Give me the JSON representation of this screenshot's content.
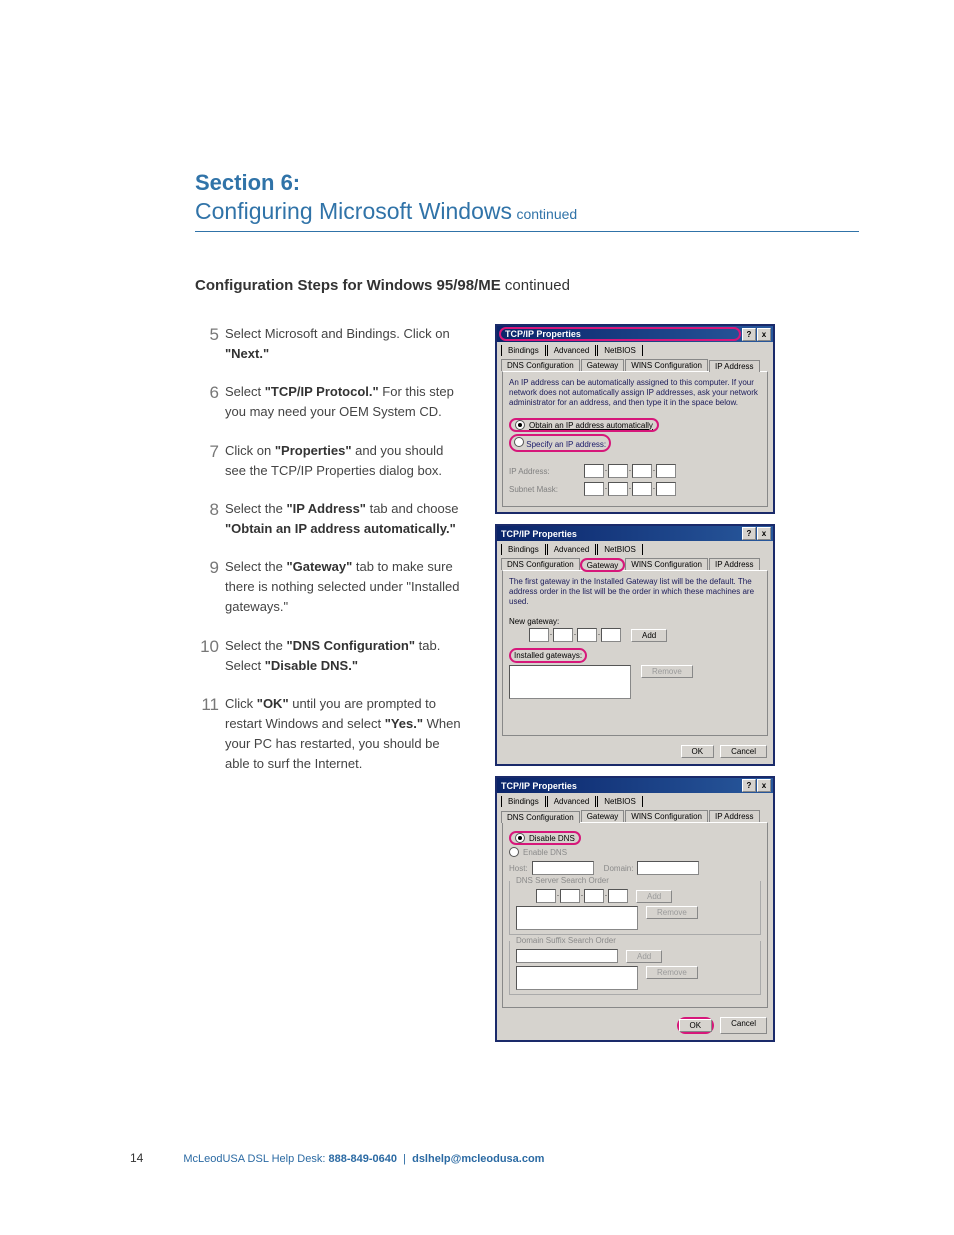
{
  "section": {
    "number": "Section 6:",
    "title": "Configuring Microsoft Windows",
    "cont": "continued"
  },
  "subhead": {
    "text": "Configuration Steps for Windows 95/98/ME",
    "cont": "continued"
  },
  "steps": [
    {
      "n": "5",
      "html": "Select Microsoft and Bindings. Click on <b>\"Next.\"</b>"
    },
    {
      "n": "6",
      "html": "Select <b>\"TCP/IP Protocol.\"</b> For this step you may need your OEM System CD."
    },
    {
      "n": "7",
      "html": "Click on <b>\"Properties\"</b> and you should see the TCP/IP Properties dialog box."
    },
    {
      "n": "8",
      "html": "Select the <b>\"IP Address\"</b> tab and choose <b>\"Obtain an IP address automatically.\"</b>"
    },
    {
      "n": "9",
      "html": "Select the <b>\"Gateway\"</b> tab to make sure there is nothing selected under \"Installed gateways.\""
    },
    {
      "n": "10",
      "html": "Select the <b>\"DNS Configuration\"</b> tab. Select <b>\"Disable DNS.\"</b>"
    },
    {
      "n": "11",
      "html": "Click <b>\"OK\"</b> until you are prompted to restart Windows and select <b>\"Yes.\"</b> When your PC has restarted, you should be able to surf the Internet."
    }
  ],
  "dialog": {
    "title": "TCP/IP Properties",
    "help": "?",
    "close": "x",
    "tabs_top": [
      "Bindings",
      "Advanced",
      "NetBIOS"
    ],
    "tabs_bot": [
      "DNS Configuration",
      "Gateway",
      "WINS Configuration",
      "IP Address"
    ],
    "ip": {
      "note": "An IP address can be automatically assigned to this computer. If your network does not automatically assign IP addresses, ask your network administrator for an address, and then type it in the space below.",
      "r1": "Obtain an IP address automatically",
      "r2": "Specify an IP address:",
      "f1": "IP Address:",
      "f2": "Subnet Mask:"
    },
    "gw": {
      "note": "The first gateway in the Installed Gateway list will be the default. The address order in the list will be the order in which these machines are used.",
      "new": "New gateway:",
      "add": "Add",
      "inst": "Installed gateways:",
      "remove": "Remove",
      "ok": "OK",
      "cancel": "Cancel"
    },
    "dns": {
      "r1": "Disable DNS",
      "r2": "Enable DNS",
      "host": "Host:",
      "domain": "Domain:",
      "order": "DNS Server Search Order",
      "suffix": "Domain Suffix Search Order",
      "add": "Add",
      "remove": "Remove",
      "ok": "OK",
      "cancel": "Cancel"
    }
  },
  "footer": {
    "page": "14",
    "brand": "McLeodUSA DSL Help Desk:",
    "phone": "888-849-0640",
    "sep": "|",
    "email": "dslhelp@mcleodusa.com"
  }
}
